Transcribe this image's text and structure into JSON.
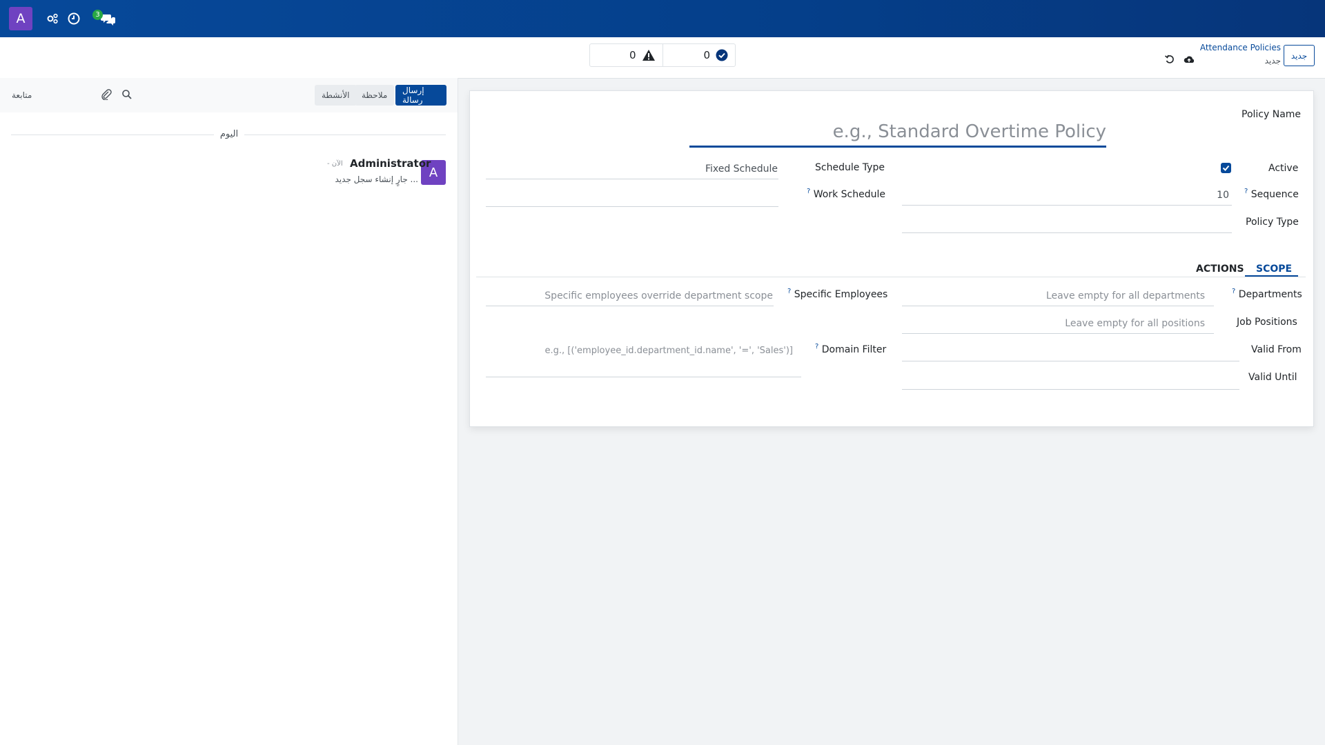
{
  "navbar": {
    "avatar_letter": "A",
    "icons": [
      "gears-icon",
      "clock-icon",
      "chat-icon"
    ],
    "chat_badge": "3"
  },
  "control_panel": {
    "stat_warning_count": "0",
    "stat_success_count": "0",
    "breadcrumb_title": "Attendance Policies",
    "breadcrumb_sub": "جديد",
    "new_button": "جديد"
  },
  "chatter": {
    "send_message": "إرسال رسالة",
    "log_note": "ملاحظة",
    "activities": "الأنشطة",
    "follow": "متابعة",
    "day_label": "اليوم",
    "message": {
      "avatar_letter": "A",
      "author": "Administrator",
      "date": "- الآن",
      "body": "جارٍ إنشاء سجل جديد ..."
    }
  },
  "form": {
    "policy_name_label": "Policy Name",
    "policy_name_placeholder": "e.g., Standard Overtime Policy",
    "active_label": "Active",
    "active_checked": true,
    "sequence_label": "Sequence",
    "sequence_value": "10",
    "policy_type_label": "Policy Type",
    "schedule_type_label": "Schedule Type",
    "schedule_type_value": "Fixed Schedule",
    "work_schedule_label": "Work Schedule",
    "tabs": [
      "SCOPE",
      "ACTIONS"
    ],
    "active_tab": "SCOPE",
    "departments_label": "Departments",
    "departments_placeholder": "Leave empty for all departments",
    "job_positions_label": "Job Positions",
    "job_positions_placeholder": "Leave empty for all positions",
    "valid_from_label": "Valid From",
    "valid_until_label": "Valid Until",
    "specific_employees_label": "Specific Employees",
    "specific_employees_placeholder": "Specific employees override department scope",
    "domain_filter_label": "Domain Filter",
    "domain_filter_placeholder": "e.g., [('employee_id.department_id.name', '=', 'Sales')]",
    "help_mark": "?"
  },
  "colors": {
    "brand": "#06499a",
    "avatar": "#6f42c1",
    "badge": "#28a745"
  }
}
